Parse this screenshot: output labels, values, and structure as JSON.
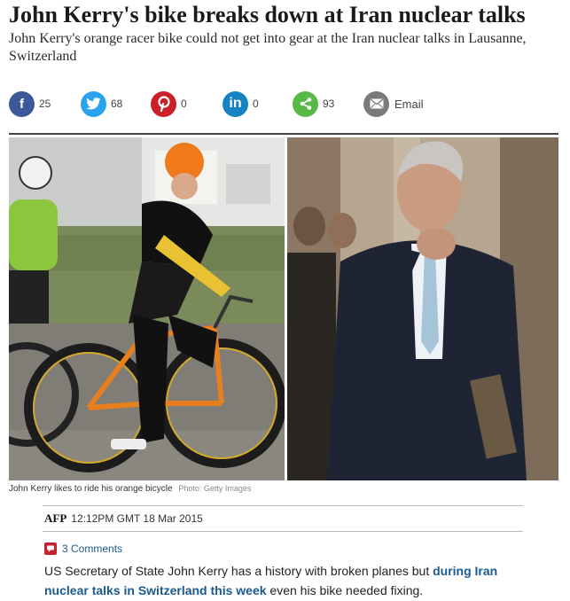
{
  "article": {
    "headline": "John Kerry's bike breaks down at Iran nuclear talks",
    "standfirst": "John Kerry's orange racer bike could not get into gear at the Iran nuclear talks in Lausanne, Switzerland"
  },
  "share": {
    "facebook": {
      "icon": "facebook-icon",
      "glyph": "f",
      "color": "#3b5998",
      "count": "25"
    },
    "twitter": {
      "icon": "twitter-icon",
      "color": "#2aa3ef",
      "count": "68"
    },
    "pinterest": {
      "icon": "pinterest-icon",
      "glyph": "p",
      "color": "#cb2027",
      "count": "0"
    },
    "linkedin": {
      "icon": "linkedin-icon",
      "glyph": "in",
      "color": "#1682c4",
      "count": "0"
    },
    "share": {
      "icon": "share-icon",
      "color": "#58b947",
      "count": "93"
    },
    "email": {
      "icon": "email-icon",
      "color": "#7a7a7a",
      "label": "Email"
    }
  },
  "photo": {
    "caption": "John Kerry likes to ride his orange bicycle",
    "credit": "Photo: Getty Images"
  },
  "byline": {
    "source": "AFP",
    "timestamp": "12:12PM GMT 18 Mar 2015"
  },
  "comments": {
    "icon": "comment-icon",
    "label": "3 Comments"
  },
  "body": {
    "text_before": "US Secretary of State John Kerry has a history with broken planes but ",
    "link_text": "during Iran nuclear talks in Switzerland this week",
    "text_after": " even his bike needed fixing."
  }
}
